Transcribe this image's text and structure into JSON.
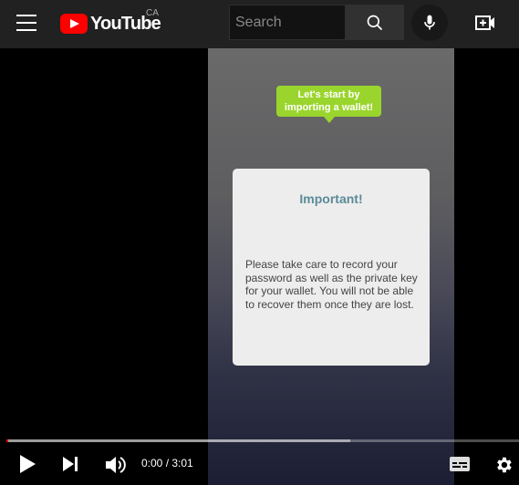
{
  "header": {
    "logo_text": "YouTube",
    "country_code": "CA",
    "search_placeholder": "Search"
  },
  "video": {
    "callout_text": "Let's start by importing a wallet!",
    "dialog_title": "Important!",
    "dialog_body": "Please take care to record your password as well as the private key for your wallet. You will not be able to recover them once they are lost."
  },
  "player": {
    "current_time": "0:00",
    "separator": " / ",
    "duration": "3:01",
    "buffered_fraction": 0.67,
    "played_fraction": 0.0
  },
  "colors": {
    "brand": "#ff0000",
    "callout": "#9ad52d",
    "dialog_title": "#5a8a98"
  }
}
